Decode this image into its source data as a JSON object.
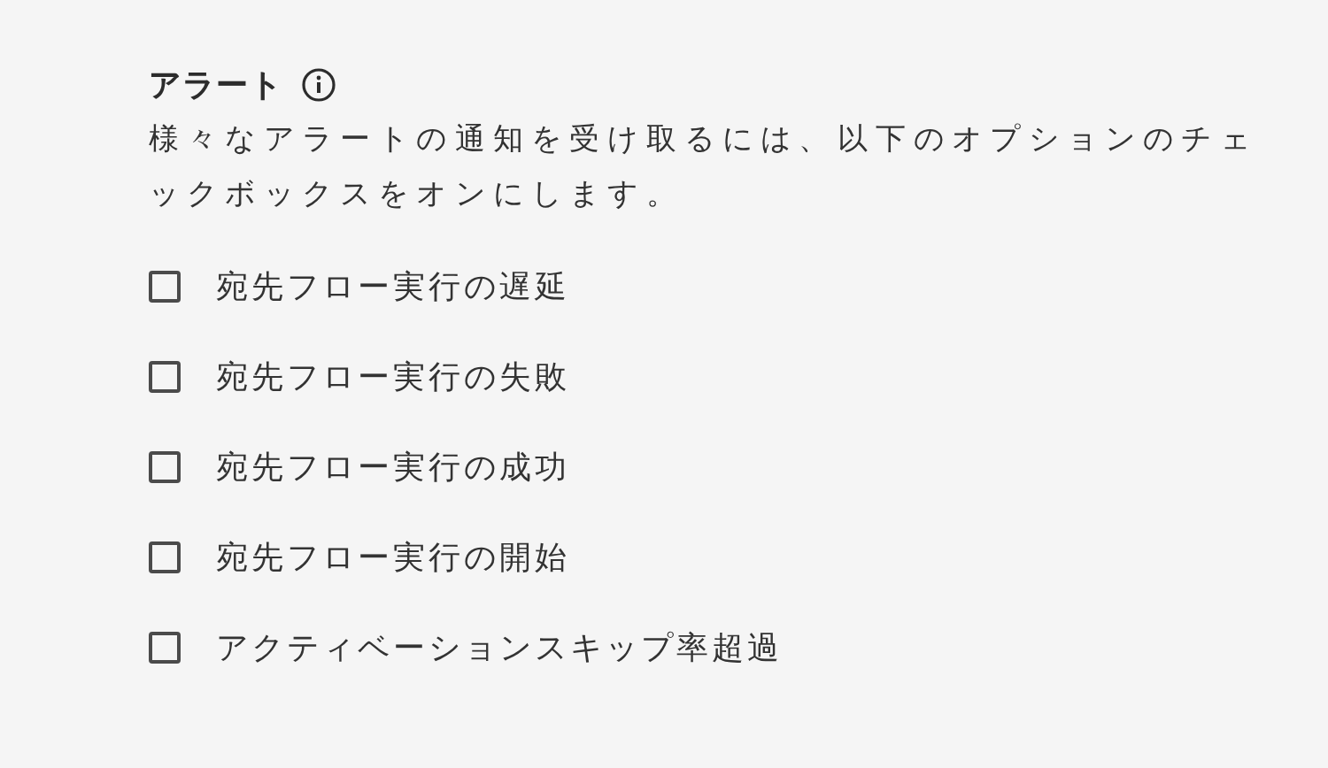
{
  "title": "アラート",
  "description": "様々なアラートの通知を受け取るには、以下のオプションのチェックボックスをオンにします。",
  "options": [
    {
      "label": "宛先フロー実行の遅延",
      "checked": false
    },
    {
      "label": "宛先フロー実行の失敗",
      "checked": false
    },
    {
      "label": "宛先フロー実行の成功",
      "checked": false
    },
    {
      "label": "宛先フロー実行の開始",
      "checked": false
    },
    {
      "label": "アクティベーションスキップ率超過",
      "checked": false
    }
  ]
}
